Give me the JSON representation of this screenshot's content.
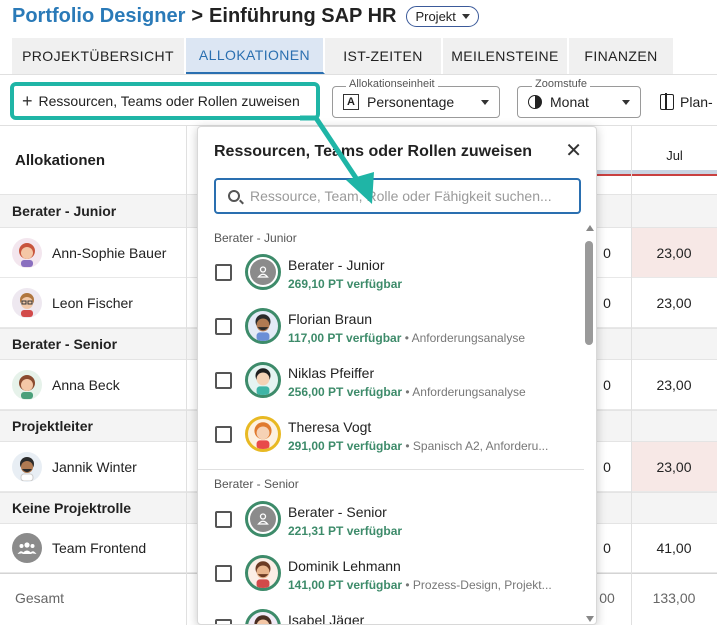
{
  "header": {
    "brand": "Portfolio Designer",
    "separator": ">",
    "project_title": "Einführung SAP HR",
    "badge": "Projekt"
  },
  "tabs": [
    {
      "label": "PROJEKTÜBERSICHT",
      "active": false
    },
    {
      "label": "ALLOKATIONEN",
      "active": true
    },
    {
      "label": "IST-ZEITEN",
      "active": false
    },
    {
      "label": "MEILENSTEINE",
      "active": false
    },
    {
      "label": "FINANZEN",
      "active": false
    }
  ],
  "toolbar": {
    "assign_label": "Ressourcen, Teams oder Rollen zuweisen",
    "unit_label": "Allokationseinheit",
    "unit_value": "Personentage",
    "zoom_label": "Zoomstufe",
    "zoom_value": "Monat",
    "plan_label": "Plan-"
  },
  "grid": {
    "title": "Allokationen",
    "month": "Jul",
    "groups": [
      {
        "label": "Berater - Junior"
      },
      {
        "label": "Berater - Senior"
      },
      {
        "label": "Projektleiter"
      },
      {
        "label": "Keine Projektrolle"
      }
    ],
    "rows": [
      {
        "name": "Ann-Sophie Bauer",
        "prev": "0",
        "value": "23,00",
        "highlight": true,
        "avatar": "woman-red-hair-icon"
      },
      {
        "name": "Leon Fischer",
        "prev": "0",
        "value": "23,00",
        "highlight": false,
        "avatar": "man-glasses-icon"
      },
      {
        "name": "Anna Beck",
        "prev": "0",
        "value": "23,00",
        "highlight": false,
        "avatar": "woman-brown-hair-icon"
      },
      {
        "name": "Jannik Winter",
        "prev": "0",
        "value": "23,00",
        "highlight": true,
        "avatar": "man-beard-icon"
      },
      {
        "name": "Team Frontend",
        "prev": "0",
        "value": "41,00",
        "highlight": false,
        "avatar": "team-icon"
      }
    ],
    "total": {
      "label": "Gesamt",
      "prev": "00",
      "value": "133,00"
    }
  },
  "popover": {
    "title": "Ressourcen, Teams oder Rollen zuweisen",
    "search_placeholder": "Ressource, Team, Rolle oder Fähigkeit suchen...",
    "sections": [
      {
        "label": "Berater - Junior",
        "items": [
          {
            "name": "Berater - Junior",
            "available": "269,10 PT verfügbar",
            "skills": "",
            "avatar": "role-person-icon"
          },
          {
            "name": "Florian Braun",
            "available": "117,00 PT verfügbar",
            "skills": " • Anforderungsanalyse",
            "avatar": "man-beard-icon"
          },
          {
            "name": "Niklas Pfeiffer",
            "available": "256,00 PT verfügbar",
            "skills": " • Anforderungsanalyse",
            "avatar": "man-black-hair-icon"
          },
          {
            "name": "Theresa Vogt",
            "available": "291,00 PT verfügbar",
            "skills": " • Spanisch A2, Anforderu...",
            "avatar": "woman-orange-hair-icon"
          }
        ]
      },
      {
        "label": "Berater - Senior",
        "items": [
          {
            "name": "Berater - Senior",
            "available": "221,31 PT verfügbar",
            "skills": "",
            "avatar": "role-person-icon"
          },
          {
            "name": "Dominik Lehmann",
            "available": "141,00 PT verfügbar",
            "skills": " • Prozess-Design, Projekt...",
            "avatar": "man-beard-icon"
          },
          {
            "name": "Isabel Jäger",
            "available": "",
            "skills": "",
            "avatar": "woman-icon"
          }
        ]
      }
    ]
  },
  "colors": {
    "brand": "#2a7ab8",
    "highlight_border": "#1fb5a6",
    "available_text": "#3d8b6a",
    "active_tab_bg": "#dce6f3",
    "cell_highlight": "#f7e8e6"
  }
}
